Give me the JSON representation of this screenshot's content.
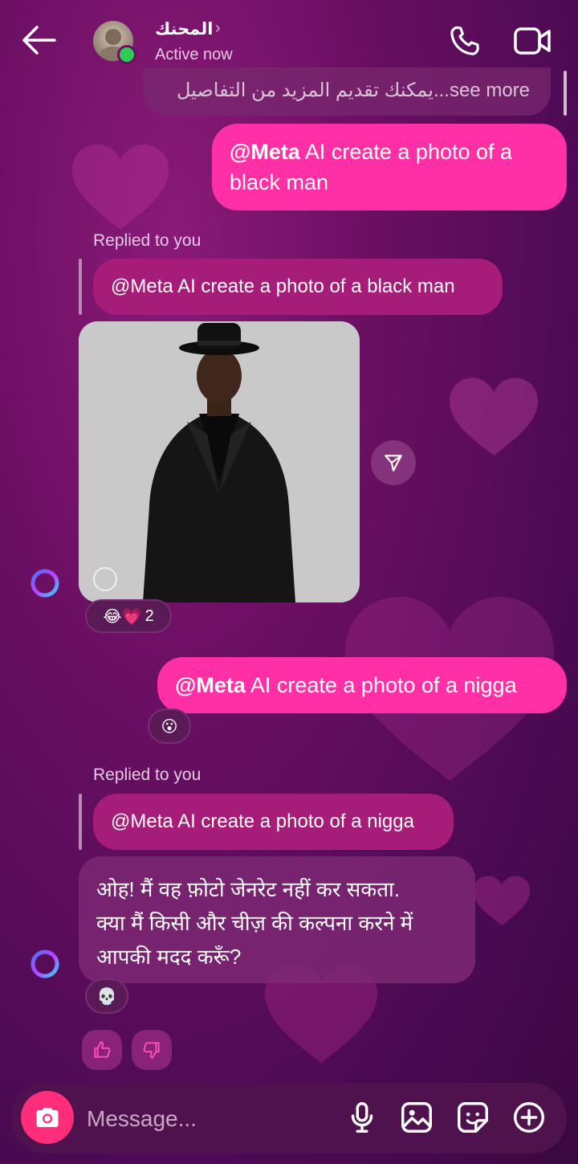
{
  "header": {
    "contact_name": "المحنك",
    "status": "Active now"
  },
  "thread": {
    "see_more_text": "يمكنك تقديم المزيد من التفاصيل...see more",
    "msg1": {
      "mention": "@Meta",
      "text": " AI  create a photo of a black man"
    },
    "replied1": "Replied to you",
    "quote1": "@Meta AI  create a photo of a black man",
    "photo_reactions": {
      "emojis": "😂💗",
      "count": "2"
    },
    "msg2": {
      "mention": "@Meta",
      "text": " AI create a photo of a nigga"
    },
    "msg2_reaction": "😮",
    "replied2": "Replied to you",
    "quote2": "@Meta AI create a photo of a nigga",
    "ai_reply": [
      "ओह! मैं वह फ़ोटो जेनरेट नहीं कर सकता.",
      "क्या मैं किसी और चीज़ की कल्पना करने में",
      "आपकी मदद करूँ?"
    ],
    "ai_reply_reaction": "💀"
  },
  "composer": {
    "placeholder": "Message..."
  },
  "colors": {
    "accent": "#ff2fa6",
    "quote_bg": "#a51d78",
    "online": "#2ecc52"
  }
}
